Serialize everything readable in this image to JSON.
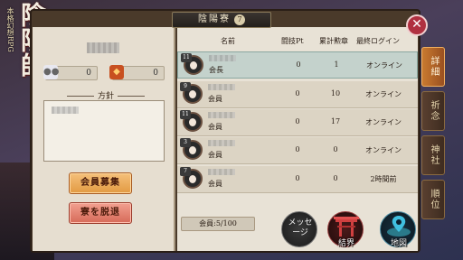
{
  "logo": {
    "main": "陰陽師",
    "sub": "本格幻想RPG"
  },
  "header": {
    "title": "陰陽寮",
    "level": "7"
  },
  "left": {
    "stats": [
      {
        "icon": "spirit-orb-icon",
        "value": "0"
      },
      {
        "icon": "treasure-icon",
        "value": "0"
      }
    ],
    "policy_label": "方針",
    "buttons": {
      "recruit": "会員募集",
      "leave": "寮を脱退"
    }
  },
  "table": {
    "headers": {
      "name": "名前",
      "pt": "闘技Pt",
      "medals": "累計勲章",
      "login": "最終ログイン"
    },
    "rows": [
      {
        "level": "11",
        "role": "会長",
        "pt": "0",
        "medals": "1",
        "login": "オンライン",
        "selected": true
      },
      {
        "level": "9",
        "role": "会員",
        "pt": "0",
        "medals": "10",
        "login": "オンライン",
        "selected": false
      },
      {
        "level": "11",
        "role": "会員",
        "pt": "0",
        "medals": "17",
        "login": "オンライン",
        "selected": false
      },
      {
        "level": "3",
        "role": "会員",
        "pt": "0",
        "medals": "0",
        "login": "オンライン",
        "selected": false
      },
      {
        "level": "7",
        "role": "会員",
        "pt": "0",
        "medals": "0",
        "login": "2時間前",
        "selected": false
      }
    ],
    "member_count": "会員:5/100"
  },
  "tabs": [
    "詳細",
    "祈念",
    "神社",
    "順位"
  ],
  "bottom": {
    "message": "メッセージ",
    "kekkai": "結界",
    "map": "地図"
  }
}
